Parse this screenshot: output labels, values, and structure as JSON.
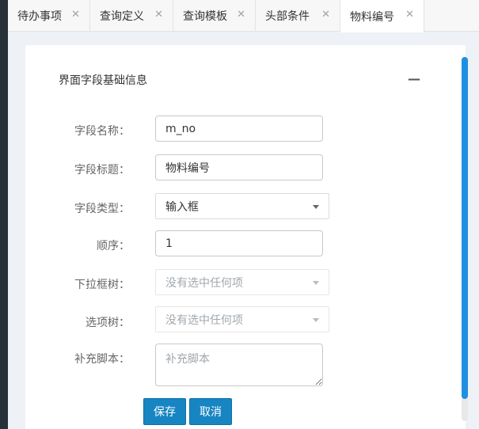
{
  "tabs": [
    {
      "label": "待办事项",
      "close": "✕"
    },
    {
      "label": "查询定义",
      "close": "✕"
    },
    {
      "label": "查询模板",
      "close": "✕"
    },
    {
      "label": "头部条件",
      "close": "✕"
    },
    {
      "label": "物料编号",
      "close": "✕",
      "active": true
    }
  ],
  "section": {
    "title": "界面字段基础信息",
    "collapse_symbol": "—"
  },
  "form": {
    "field_name": {
      "label": "字段名称：",
      "value": "m_no"
    },
    "field_title": {
      "label": "字段标题：",
      "value": "物料编号"
    },
    "field_type": {
      "label": "字段类型：",
      "value": "输入框"
    },
    "order": {
      "label": "顺序：",
      "value": "1"
    },
    "dropdown_tree": {
      "label": "下拉框树：",
      "value": "没有选中任何项"
    },
    "option_tree": {
      "label": "选项树：",
      "value": "没有选中任何项"
    },
    "extra_script": {
      "label": "补充脚本：",
      "placeholder": "补充脚本"
    }
  },
  "buttons": {
    "save": "保存",
    "cancel": "取消"
  },
  "colors": {
    "accent": "#1785c2",
    "sidebar": "#263238",
    "scrollbar": "#1e90e0"
  }
}
